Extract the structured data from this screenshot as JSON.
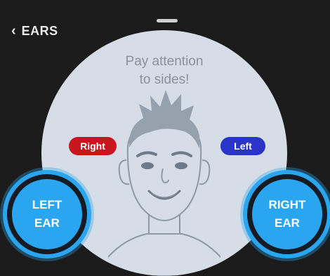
{
  "header": {
    "back_icon": "chevron-left-icon",
    "title": "EARS"
  },
  "instruction": {
    "line1": "Pay attention",
    "line2": "to sides!"
  },
  "labels": {
    "right": "Right",
    "left": "Left",
    "right_color": "#c8151e",
    "left_color": "#2a34c8"
  },
  "buttons": {
    "left_ear": {
      "line1": "LEFT",
      "line2": "EAR"
    },
    "right_ear": {
      "line1": "RIGHT",
      "line2": "EAR"
    },
    "color": "#2aa6f0"
  },
  "colors": {
    "background": "#1b1b1b",
    "circle": "#d6dde7"
  }
}
